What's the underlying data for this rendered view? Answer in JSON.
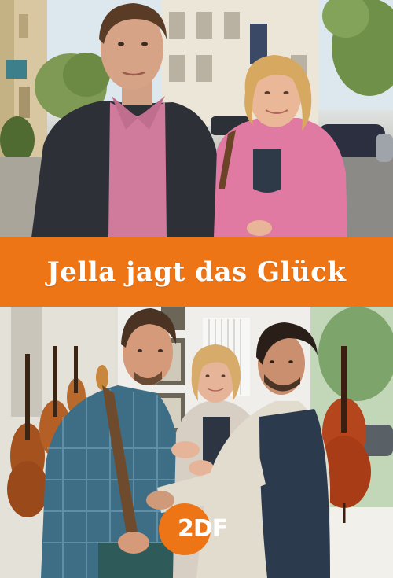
{
  "poster": {
    "title": "Jella jagt das Glück",
    "logo_text": "2DF",
    "colors": {
      "title_band": "#ee7516",
      "title_text": "#ffffff",
      "logo": "#ee7516"
    }
  }
}
